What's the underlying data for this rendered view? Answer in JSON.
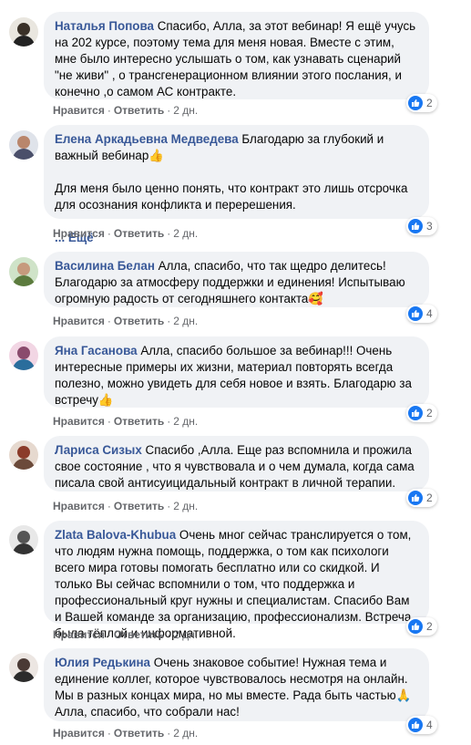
{
  "colors": {
    "author": "#385898",
    "bubble": "#f0f2f5",
    "like": "#1877f2",
    "meta": "#65676b"
  },
  "comments": [
    {
      "author": "Наталья Попова",
      "paragraphs": [
        "Спасибо, Алла, за этот вебинар! Я ещё учусь на 202 курсе, поэтому тема для меня новая. Вместе с этим, мне было интересно услышать о том, как узнавать сценарий \"не живи\" , о трансгенерационном влиянии этого послания, и конечно ,о самом АС контракте."
      ],
      "like": "Нравится",
      "reply": "Ответить",
      "time": "2 дн.",
      "reactions": "2"
    },
    {
      "author": "Елена Аркадьевна Медведева",
      "paragraphs": [
        "Благодарю за глубокий и важный вебинар",
        "Для меня было ценно понять, что контракт это лишь отсрочка для осознания конфликта и перерешения."
      ],
      "emoji_after_first": "👍",
      "more": "... Ещё",
      "like": "Нравится",
      "reply": "Ответить",
      "time": "2 дн.",
      "reactions": "3"
    },
    {
      "author": "Василина Белан",
      "paragraphs": [
        "Алла, спасибо, что так щедро делитесь! Благодарю за атмосферу поддержки и единения! Испытываю огромную радость от сегодняшнего контакта"
      ],
      "emoji_end": "🥰",
      "like": "Нравится",
      "reply": "Ответить",
      "time": "2 дн.",
      "reactions": "4"
    },
    {
      "author": "Яна Гасанова",
      "paragraphs": [
        "Алла, спасибо большое за вебинар!!! Очень интересные примеры их жизни, материал повторять всегда полезно, можно увидеть для себя новое и взять. Благодарю за встречу"
      ],
      "emoji_end": "👍",
      "like": "Нравится",
      "reply": "Ответить",
      "time": "2 дн.",
      "reactions": "2"
    },
    {
      "author": "Лариса Сизых",
      "paragraphs": [
        "Спасибо ,Алла. Еще раз вспомнила и прожила свое состояние , что я чувствовала и о чем думала, когда сама писала свой антисуицидальный контракт в личной терапии."
      ],
      "like": "Нравится",
      "reply": "Ответить",
      "time": "2 дн.",
      "reactions": "2"
    },
    {
      "author": "Zlata Balova-Khubua",
      "paragraphs": [
        "Очень мног сейчас транслируется о том, что людям нужна помощь, поддержка, о том как психологи всего мира готовы помогать бесплатно или со скидкой. И только Вы сейчас вспомнили о том, что поддержка и профессиональный круг нужны и специалистам. Спасибо Вам и Вашей команде за организацию, профессионализм. Встреча была тёплой и информативной."
      ],
      "like": "Нравится",
      "reply": "Ответить",
      "time": "2 дн.",
      "reactions": "2"
    },
    {
      "author": "Юлия Редькина",
      "paragraphs": [
        "Очень знаковое событие! Нужная тема и единение коллег, которое чувствовалось несмотря на онлайн. Мы в разных концах мира, но мы вместе. Рада быть частью",
        "Алла, спасибо, что собрали нас!"
      ],
      "emoji_mid": "🙏",
      "like": "Нравится",
      "reply": "Ответить",
      "time": "2 дн.",
      "reactions": "4"
    }
  ]
}
